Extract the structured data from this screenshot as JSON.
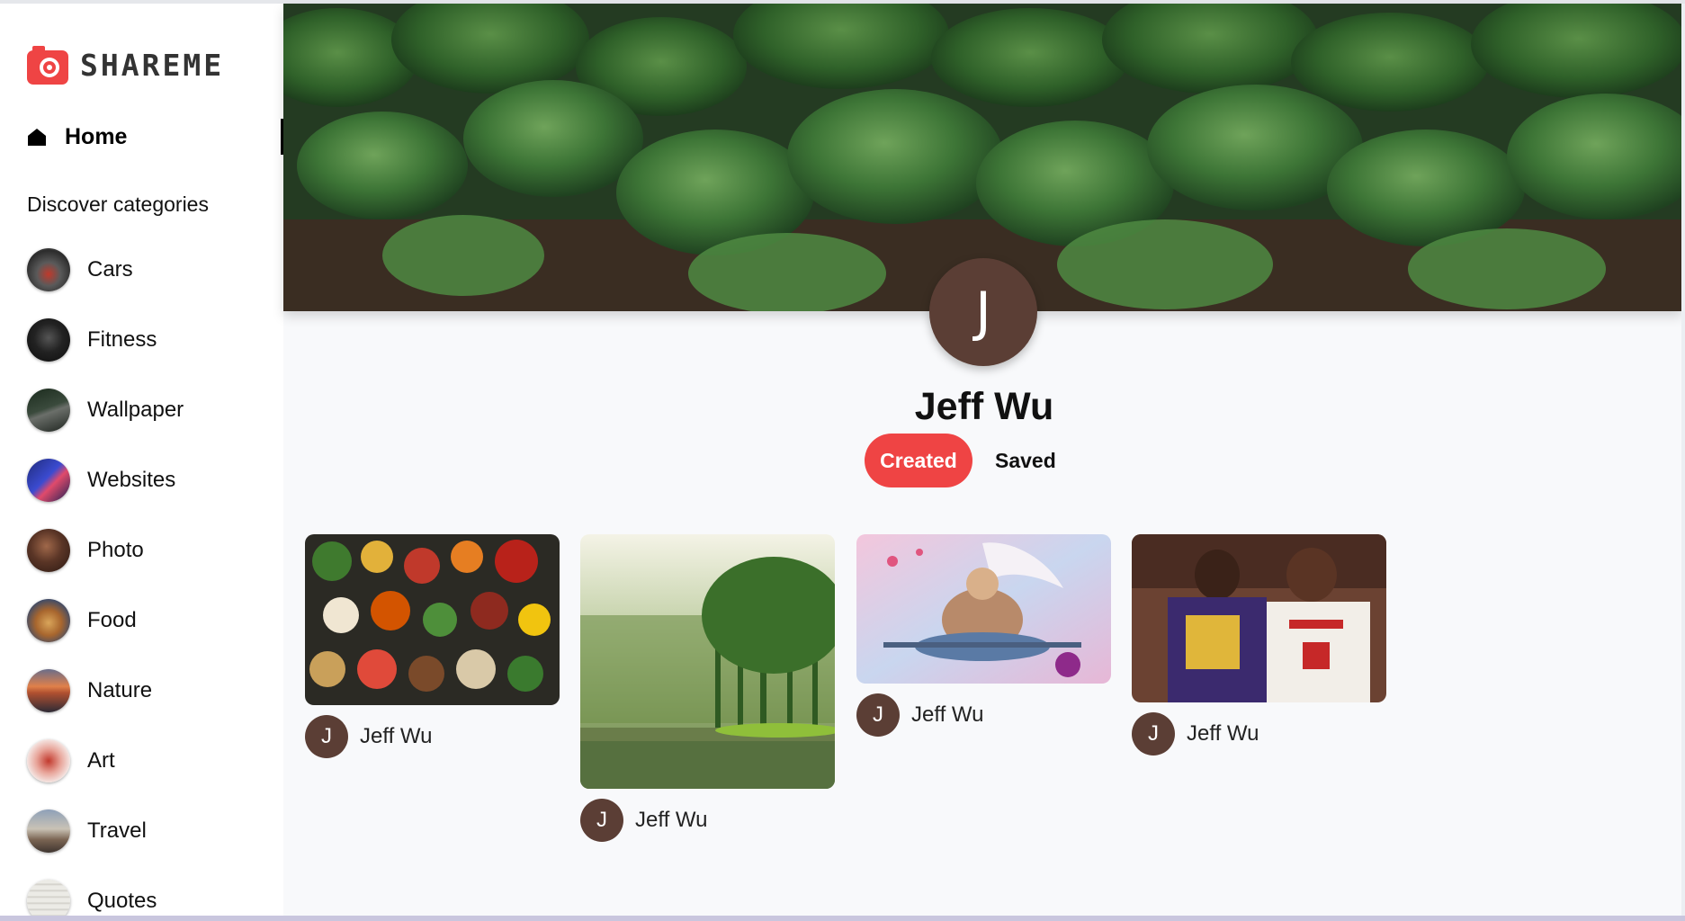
{
  "app": {
    "logo_text": "SHAREME",
    "accent": "#ef4444"
  },
  "sidebar": {
    "home_label": "Home",
    "discover_label": "Discover categories",
    "categories": [
      {
        "label": "Cars",
        "icon": "cars-thumbnail"
      },
      {
        "label": "Fitness",
        "icon": "fitness-thumbnail"
      },
      {
        "label": "Wallpaper",
        "icon": "wallpaper-thumbnail"
      },
      {
        "label": "Websites",
        "icon": "websites-thumbnail"
      },
      {
        "label": "Photo",
        "icon": "photo-thumbnail"
      },
      {
        "label": "Food",
        "icon": "food-thumbnail"
      },
      {
        "label": "Nature",
        "icon": "nature-thumbnail"
      },
      {
        "label": "Art",
        "icon": "art-thumbnail"
      },
      {
        "label": "Travel",
        "icon": "travel-thumbnail"
      },
      {
        "label": "Quotes",
        "icon": "quotes-thumbnail"
      }
    ]
  },
  "profile": {
    "initial": "J",
    "name": "Jeff Wu",
    "avatar_color": "#5b3e35",
    "tabs": {
      "created": "Created",
      "saved": "Saved",
      "active": "created"
    }
  },
  "pins": [
    {
      "image": "vegetables-spread",
      "author_initial": "J",
      "author": "Jeff Wu"
    },
    {
      "image": "forest-lake",
      "author_initial": "J",
      "author": "Jeff Wu"
    },
    {
      "image": "anime-warrior-art",
      "author_initial": "J",
      "author": "Jeff Wu"
    },
    {
      "image": "basketball-players",
      "author_initial": "J",
      "author": "Jeff Wu"
    }
  ]
}
